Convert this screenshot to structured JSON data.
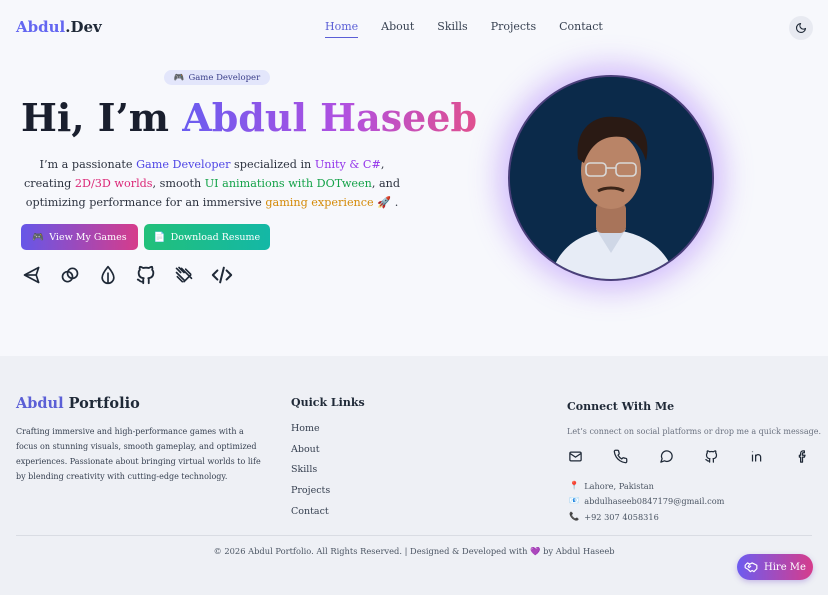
{
  "nav": {
    "logo_first": "Abdul",
    "logo_second": ".Dev",
    "links": [
      {
        "label": "Home"
      },
      {
        "label": "About"
      },
      {
        "label": "Skills"
      },
      {
        "label": "Projects"
      },
      {
        "label": "Contact"
      }
    ],
    "theme_icon": "moon-icon"
  },
  "hero": {
    "badge_icon": "🎮",
    "badge": "Game Developer",
    "title_greeting": "Hi, I’m",
    "title_name": "Abdul Haseeb",
    "desc": {
      "p1": "I’m a passionate",
      "h1": "Game Developer",
      "p2": "specialized in",
      "h2": "Unity & C#",
      "p3": ", creating",
      "h3": "2D/3D worlds",
      "p4": ", smooth",
      "h4": "UI animations with DOTween",
      "p5": ", and optimizing performance for an immersive",
      "h5": "gaming experience",
      "p6": "🚀 ."
    },
    "btn_games_icon": "🎮",
    "btn_games": "View My Games",
    "btn_resume_icon": "📄",
    "btn_resume": "Download Resume",
    "tech_icons": [
      "unity-icon",
      "link-icon",
      "feather-icon",
      "github-icon",
      "brush-icon",
      "code-icon"
    ]
  },
  "footer": {
    "brand_first": "Abdul",
    "brand_second": "Portfolio",
    "description": "Crafting immersive and high-performance games with a focus on stunning visuals, smooth gameplay, and optimized experiences. Passionate about bringing virtual worlds to life by blending creativity with cutting-edge technology.",
    "quick_links_title": "Quick Links",
    "quick_links": [
      "Home",
      "About",
      "Skills",
      "Projects",
      "Contact"
    ],
    "connect_title": "Connect With Me",
    "connect_sub": "Let’s connect on social platforms or drop me a quick message.",
    "social_icons": [
      "mail-icon",
      "phone-icon",
      "chat-icon",
      "github-icon",
      "linkedin-icon",
      "facebook-icon"
    ],
    "location_icon": "📍",
    "location": "Lahore, Pakistan",
    "email_icon": "📧",
    "email": "abdulhaseeb0847179@gmail.com",
    "phone_icon": "📞",
    "phone": "+92 307 4058316",
    "copyright_pre": "© 2026 Abdul Portfolio. All Rights Reserved. | Designed & Developed with",
    "copyright_heart": "💜",
    "copyright_post": "by Abdul Haseeb",
    "hire_label": "Hire Me"
  },
  "colors": {
    "accent": "#5b5fd6",
    "gradient_start": "#6a5cf0",
    "gradient_end": "#e0508f",
    "green": "#22c07a"
  }
}
